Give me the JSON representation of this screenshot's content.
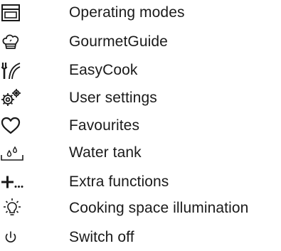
{
  "menu": {
    "items": [
      {
        "label": "Operating modes",
        "icon": "operating-modes-icon"
      },
      {
        "label": "GourmetGuide",
        "icon": "chef-hat-icon"
      },
      {
        "label": "EasyCook",
        "icon": "fork-curve-icon"
      },
      {
        "label": "User settings",
        "icon": "gears-icon"
      },
      {
        "label": "Favourites",
        "icon": "heart-icon"
      },
      {
        "label": "Water tank",
        "icon": "water-tank-icon"
      },
      {
        "label": "Extra functions",
        "icon": "plus-more-icon"
      },
      {
        "label": "Cooking space illumination",
        "icon": "light-bulb-icon"
      },
      {
        "label": "Switch off",
        "icon": "power-icon"
      }
    ]
  }
}
